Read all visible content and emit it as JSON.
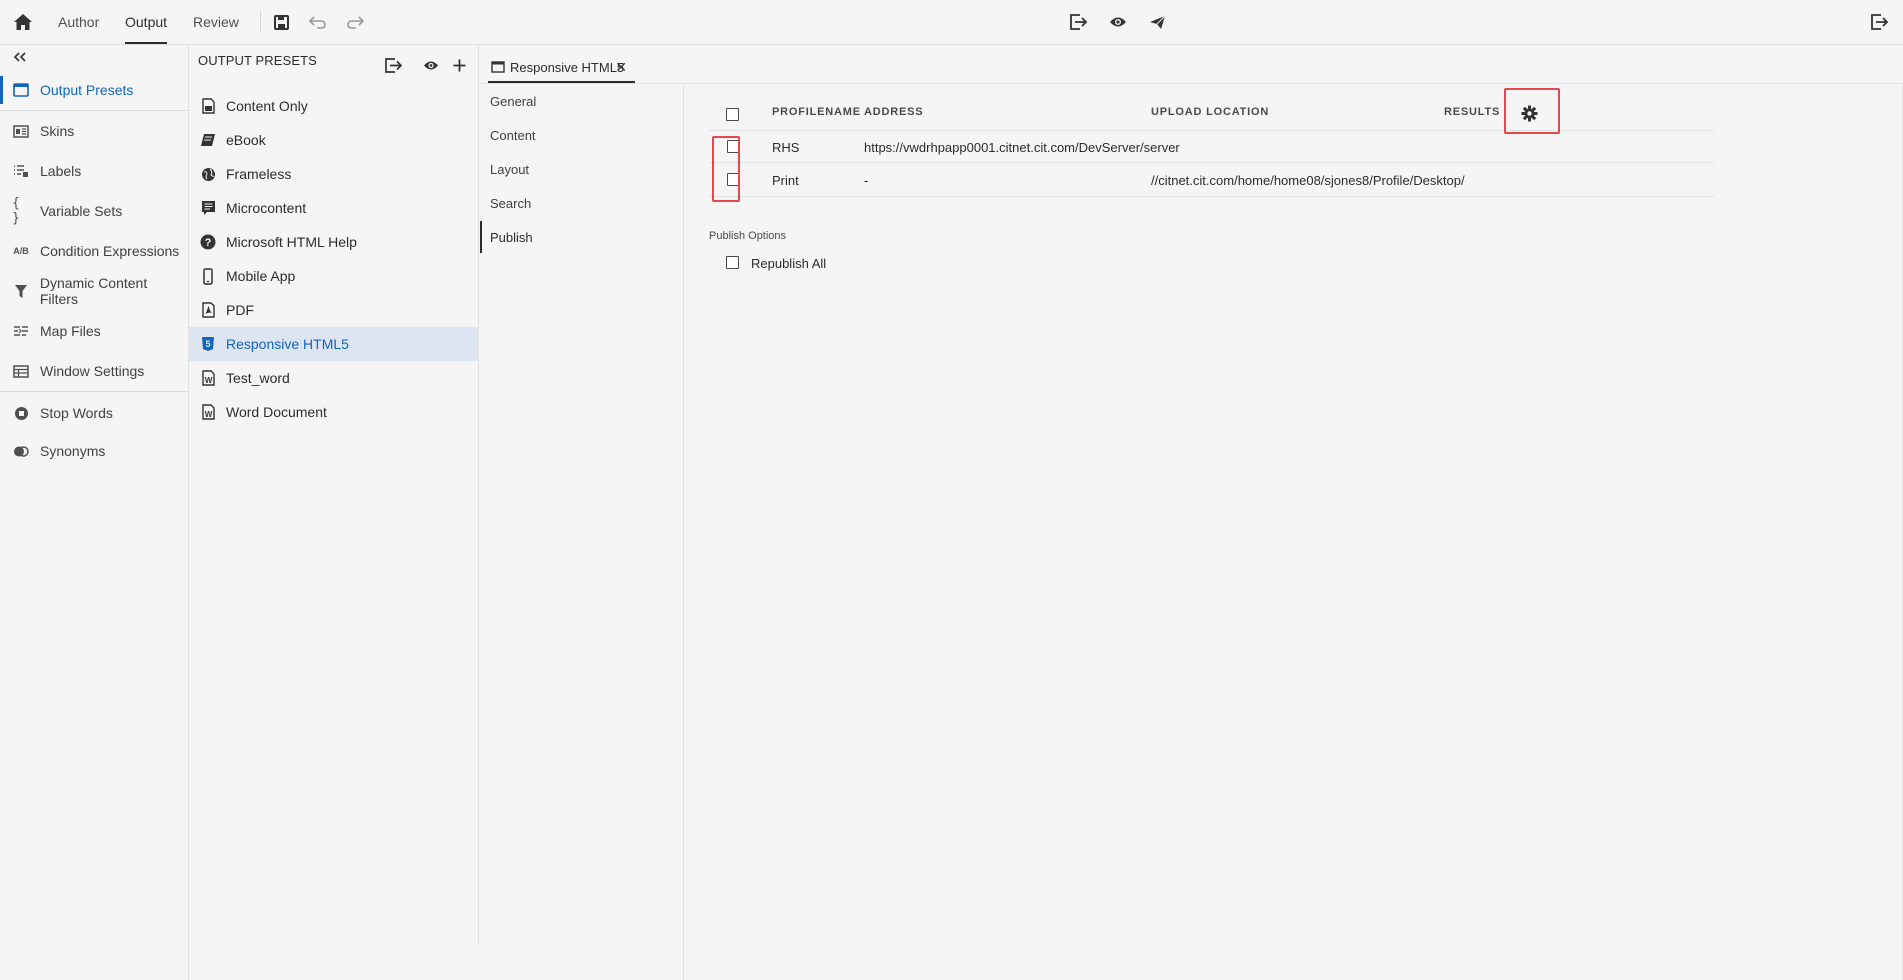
{
  "topbar": {
    "tabs": [
      {
        "label": "Author",
        "active": false
      },
      {
        "label": "Output",
        "active": true
      },
      {
        "label": "Review",
        "active": false
      }
    ],
    "icons": [
      "home-icon",
      "save-icon",
      "undo-icon",
      "redo-icon",
      "export-icon",
      "preview-icon",
      "publish-icon",
      "exit-icon"
    ]
  },
  "rail": {
    "collapse_icon": "double-chevron-left-icon",
    "items": [
      {
        "label": "Output Presets",
        "icon": "output-presets-icon",
        "active": true
      },
      {
        "label": "Skins",
        "icon": "skins-icon"
      },
      {
        "label": "Labels",
        "icon": "labels-icon"
      },
      {
        "label": "Variable Sets",
        "icon": "variable-sets-icon"
      },
      {
        "label": "Condition Expressions",
        "icon": "condition-expressions-icon"
      },
      {
        "label": "Dynamic Content Filters",
        "icon": "filter-icon"
      },
      {
        "label": "Map Files",
        "icon": "map-files-icon"
      },
      {
        "label": "Window Settings",
        "icon": "window-settings-icon"
      },
      {
        "label": "Stop Words",
        "icon": "stop-words-icon"
      },
      {
        "label": "Synonyms",
        "icon": "synonyms-icon"
      }
    ],
    "condition_glyph": "A/B",
    "variable_glyph": "{ }"
  },
  "presets": {
    "title": "OUTPUT PRESETS",
    "items": [
      {
        "label": "Content Only",
        "icon": "content-only-icon"
      },
      {
        "label": "eBook",
        "icon": "ebook-icon"
      },
      {
        "label": "Frameless",
        "icon": "globe-icon"
      },
      {
        "label": "Microcontent",
        "icon": "microcontent-icon"
      },
      {
        "label": "Microsoft HTML Help",
        "icon": "help-icon"
      },
      {
        "label": "Mobile App",
        "icon": "mobile-icon"
      },
      {
        "label": "PDF",
        "icon": "pdf-icon"
      },
      {
        "label": "Responsive HTML5",
        "icon": "html5-icon",
        "active": true
      },
      {
        "label": "Test_word",
        "icon": "word-icon"
      },
      {
        "label": "Word Document",
        "icon": "word-icon"
      }
    ],
    "glyphs": {
      "help": "?",
      "html5": "5",
      "word": "W",
      "content_only": "x"
    }
  },
  "editor": {
    "tab_label": "Responsive HTML5",
    "close_glyph": "✕",
    "categories": [
      {
        "label": "General"
      },
      {
        "label": "Content"
      },
      {
        "label": "Layout"
      },
      {
        "label": "Search"
      },
      {
        "label": "Publish",
        "active": true
      }
    ]
  },
  "publish": {
    "columns": [
      "PROFILENAME",
      "ADDRESS",
      "UPLOAD LOCATION",
      "RESULTS"
    ],
    "rows": [
      {
        "profile": "RHS",
        "address": "https://vwdrhpapp0001.citnet.cit.com/DevServer/server",
        "upload_location": "",
        "results": ""
      },
      {
        "profile": "Print",
        "address": "-",
        "upload_location": "//citnet.cit.com/home/home08/sjones8/Profile/Desktop/",
        "results": ""
      }
    ],
    "options_label": "Publish Options",
    "republish_label": "Republish All",
    "settings_icon": "gear-icon",
    "highlight_color": "#e34850"
  },
  "colors": {
    "accent": "#1464be",
    "active_bg": "#dee5f2",
    "background": "#f5f5f5"
  }
}
